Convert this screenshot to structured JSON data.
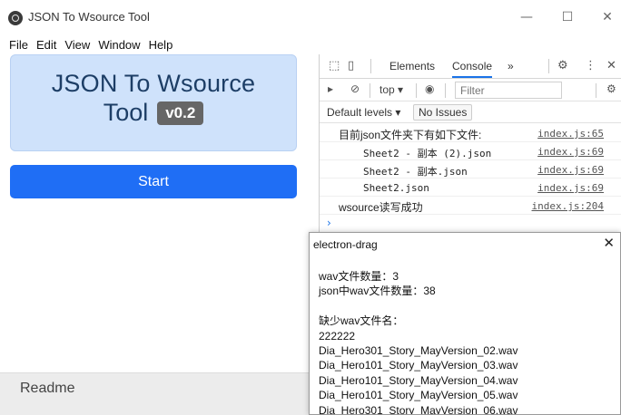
{
  "window": {
    "title": "JSON To Wsource Tool",
    "minimize": "—",
    "maximize": "☐",
    "close": "✕"
  },
  "menu": [
    "File",
    "Edit",
    "View",
    "Window",
    "Help"
  ],
  "app": {
    "hero_line1": "JSON To Wsource",
    "hero_line2": "Tool",
    "version": "v0.2",
    "start_label": "Start",
    "readme_label": "Readme"
  },
  "devtools": {
    "tabs": {
      "elements": "Elements",
      "console": "Console",
      "more": "»"
    },
    "toolbar": {
      "context": "top ▾",
      "filter_placeholder": "Filter"
    },
    "levels": {
      "default_levels": "Default levels ▾",
      "no_issues": "No Issues"
    },
    "console_lines": [
      {
        "msg": "目前json文件夹下有如下文件:",
        "src": "index.js:65"
      },
      {
        "msg": "Sheet2 - 副本 (2).json",
        "src": "index.js:69"
      },
      {
        "msg": "Sheet2 - 副本.json",
        "src": "index.js:69"
      },
      {
        "msg": "Sheet2.json",
        "src": "index.js:69"
      },
      {
        "msg": "wsource读写成功",
        "src": "index.js:204"
      }
    ],
    "prompt": "›"
  },
  "dialog": {
    "title": "electron-drag",
    "close": "✕",
    "wav_count": "wav文件数量：3",
    "json_wav_count": "json中wav文件数量：38",
    "missing_header": "缺少wav文件名：",
    "missing_files": [
      "222222",
      "Dia_Hero301_Story_MayVersion_02.wav",
      "Dia_Hero101_Story_MayVersion_03.wav",
      "Dia_Hero101_Story_MayVersion_04.wav",
      "Dia_Hero101_Story_MayVersion_05.wav",
      "Dia_Hero301_Story_MayVersion_06.wav"
    ]
  }
}
